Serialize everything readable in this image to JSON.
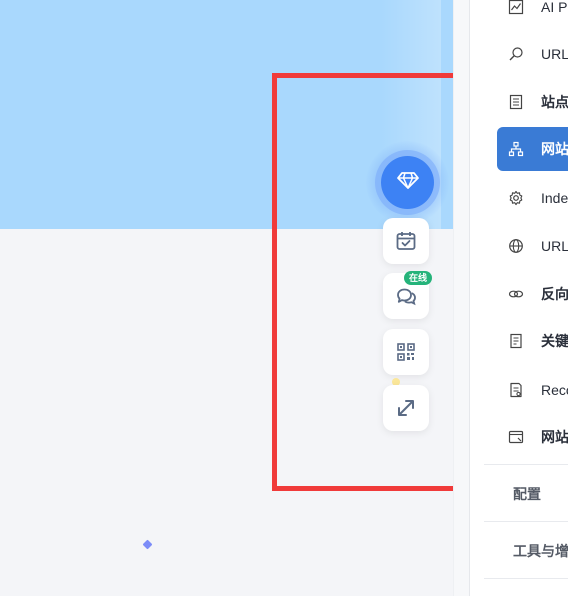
{
  "floating_toolbar": {
    "premium_icon": "diamond-icon",
    "calendar_icon": "calendar-check-icon",
    "chat_icon": "chat-bubbles-icon",
    "chat_badge": "在线",
    "qr_icon": "qr-code-icon",
    "expand_icon": "expand-arrows-icon",
    "accent_color": "#3d82f4",
    "badge_color": "#25b37a"
  },
  "highlight_color": "#f03a3a",
  "sidebar": {
    "active_color": "#3a7bd5",
    "items": [
      {
        "label": "AI Pe",
        "icon": "chart-line-icon",
        "bold": false,
        "active": false
      },
      {
        "label": "URL",
        "icon": "search-icon",
        "bold": false,
        "active": false
      },
      {
        "label": "站点",
        "icon": "document-list-icon",
        "bold": true,
        "active": false
      },
      {
        "label": "网站",
        "icon": "sitemap-icon",
        "bold": true,
        "active": true
      },
      {
        "label": "Inde",
        "icon": "gear-icon",
        "bold": false,
        "active": false
      },
      {
        "label": "URL",
        "icon": "globe-icon",
        "bold": false,
        "active": false
      },
      {
        "label": "反向",
        "icon": "link-icon",
        "bold": true,
        "active": false
      },
      {
        "label": "关键",
        "icon": "document-lines-icon",
        "bold": true,
        "active": false
      },
      {
        "label": "Reco",
        "icon": "report-icon",
        "bold": false,
        "active": false
      },
      {
        "label": "网站",
        "icon": "browser-window-icon",
        "bold": true,
        "active": false
      }
    ],
    "sections": [
      {
        "label": "配置"
      },
      {
        "label": "工具与增"
      }
    ]
  }
}
